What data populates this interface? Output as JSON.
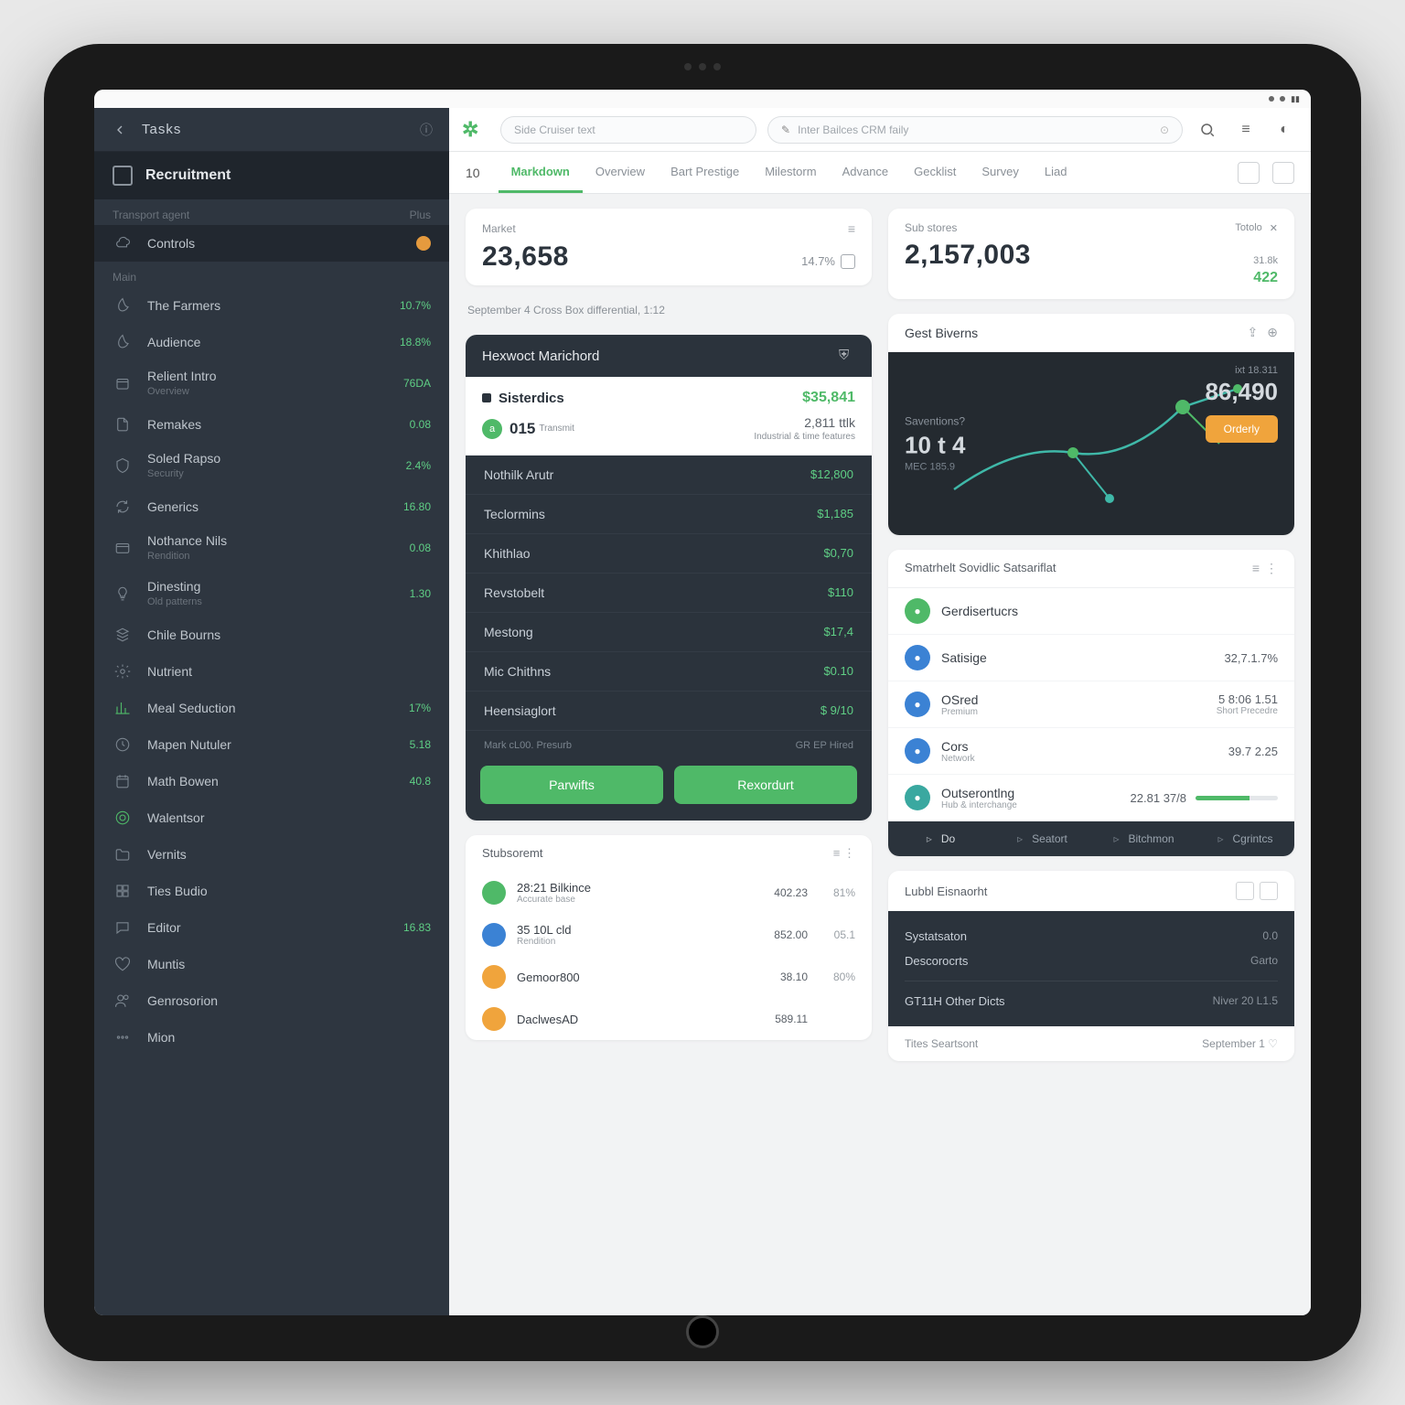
{
  "sidebar": {
    "back_title": "Tasks",
    "section": "Recruitment",
    "group1_label": "Transport agent",
    "group1_right": "Plus",
    "items": [
      {
        "icon": "cloud",
        "label": "Controls",
        "val": "",
        "active": true,
        "badge": "orange"
      },
      {
        "icon": "leaf",
        "label": "The Farmers",
        "sub": "",
        "val": "10.7%",
        "section_head": "Main"
      },
      {
        "icon": "leaf",
        "label": "Audience",
        "sub": "",
        "val": "18.8%"
      },
      {
        "icon": "box",
        "label": "Relient Intro",
        "sub": "Overview",
        "val": "76DA"
      },
      {
        "icon": "file",
        "label": "Remakes",
        "sub": "",
        "val": "0.08"
      },
      {
        "icon": "shield",
        "label": "Soled Rapso",
        "sub": "Security",
        "val": "2.4%"
      },
      {
        "icon": "refresh",
        "label": "Generics",
        "sub": "",
        "val": "16.80"
      },
      {
        "icon": "card",
        "label": "Nothance Nils",
        "sub": "Rendition",
        "val": "0.08"
      },
      {
        "icon": "bulb",
        "label": "Dinesting",
        "sub": "Old patterns",
        "val": "1.30"
      },
      {
        "icon": "stack",
        "label": "Chile Bourns",
        "sub": "",
        "val": ""
      },
      {
        "icon": "gear",
        "label": "Nutrient",
        "sub": "",
        "val": ""
      },
      {
        "icon": "chart",
        "label": "Meal Seduction",
        "sub": "",
        "val": "17%",
        "green": true
      },
      {
        "icon": "clock",
        "label": "Mapen Nutuler",
        "sub": "",
        "val": "5.18"
      },
      {
        "icon": "calendar",
        "label": "Math Bowen",
        "sub": "",
        "val": "40.8"
      },
      {
        "icon": "target",
        "label": "Walentsor",
        "sub": "",
        "val": "",
        "green": true
      },
      {
        "icon": "folder",
        "label": "Vernits",
        "sub": "",
        "val": ""
      },
      {
        "icon": "grid",
        "label": "Ties Budio",
        "sub": "",
        "val": ""
      },
      {
        "icon": "chat",
        "label": "Editor",
        "sub": "",
        "val": "16.83"
      },
      {
        "icon": "heart",
        "label": "Muntis",
        "sub": "",
        "val": ""
      },
      {
        "icon": "users",
        "label": "Genrosorion",
        "sub": "",
        "val": ""
      },
      {
        "icon": "more",
        "label": "Mion",
        "sub": "",
        "val": ""
      }
    ]
  },
  "topbar": {
    "search_placeholder": "Side  Cruiser text",
    "omni_placeholder": "Inter Bailces CRM faily"
  },
  "tabs": {
    "count": "10",
    "items": [
      "Markdown",
      "Overview",
      "Bart Prestige",
      "Milestorm",
      "Advance",
      "Gecklist",
      "Survey",
      "Liad"
    ]
  },
  "stat_left": {
    "label": "Market",
    "value": "23,658",
    "small": "14.7%"
  },
  "stat_right": {
    "label": "Sub stores",
    "value": "2,157,003",
    "tag": "Totolo",
    "delta": "422",
    "delta2": "31.8k"
  },
  "caption": "September 4 Cross Box differential, 1:12",
  "harvest": {
    "title": "Hexwoct Marichord",
    "sub_title": "Sisterdics",
    "sub_amount": "$35,841",
    "m1": "015",
    "m1_sub": "Transmit",
    "m2": "2,811 ttlk",
    "m2_sub": "Industrial & time features",
    "list": [
      {
        "name": "Nothilk Arutr",
        "val": "$12,800"
      },
      {
        "name": "Teclormins",
        "val": "$1,185"
      },
      {
        "name": "Khithlao",
        "val": "$0,70"
      },
      {
        "name": "Revstobelt",
        "val": "$110"
      },
      {
        "name": "Mestong",
        "val": "$17,4"
      },
      {
        "name": "Mic Chithns",
        "val": "$0.10"
      },
      {
        "name": "Heensiaglort",
        "val": "$ 9/10"
      }
    ],
    "foot_l": "Mark cL00. Presurb",
    "foot_r": "GR EP Hired",
    "btn1": "Parwifts",
    "btn2": "Rexordurt"
  },
  "map": {
    "title": "Gest Biverns",
    "left_label": "Saventions?",
    "left_big": "10 t 4",
    "left_sub": "MEC 185.9",
    "right_label": "ixt 18.311",
    "right_big": "86,490",
    "btn": "Orderly"
  },
  "services": {
    "title": "Smatrhelt Sovidlic Satsariflat",
    "rows": [
      {
        "color": "g",
        "name": "Gerdisertucrs",
        "sub": "",
        "val": "",
        "vsub": ""
      },
      {
        "color": "b",
        "name": "Satisige",
        "sub": "",
        "val": "32,7.1.7%",
        "vsub": ""
      },
      {
        "color": "b",
        "name": "OSred",
        "sub": "Premium",
        "val": "5 8:06 1.51",
        "vsub": "Short Precedre"
      },
      {
        "color": "b",
        "name": "Cors",
        "sub": "Network",
        "val": "39.7 2.25",
        "vsub": ""
      },
      {
        "color": "t",
        "name": "Outserontlng",
        "sub": "Hub & interchange",
        "val": "22.81 37/8",
        "vsub": ""
      }
    ],
    "tabs": [
      "Do",
      "Seatort",
      "Bitchmon",
      "Cgrintcs"
    ]
  },
  "subs": {
    "title": "Stubsoremt",
    "rows": [
      {
        "color": "g",
        "name": "28:21 Bilkince",
        "sub": "Accurate base",
        "c1": "402.23",
        "c2": "81%"
      },
      {
        "color": "b",
        "name": "35 10L cld",
        "sub": "Rendition",
        "c1": "852.00",
        "c2": "05.1"
      },
      {
        "color": "o",
        "name": "Gemoor800",
        "sub": "",
        "c1": "38.10",
        "c2": "80%"
      },
      {
        "color": "o",
        "name": "DaclwesAD",
        "sub": "",
        "c1": "589.11",
        "c2": ""
      }
    ]
  },
  "labelcard": {
    "title": "Lubbl Eisnaorht",
    "r1": {
      "k": "Systatsaton",
      "v": "0.0"
    },
    "r2": {
      "k": "Descorocrts",
      "v": "Garto"
    },
    "r3": {
      "k": "GT11H Other Dicts",
      "v": "Niver 20 L1.5"
    },
    "foot_l": "Tites Seartsont",
    "foot_r": "September 1"
  }
}
